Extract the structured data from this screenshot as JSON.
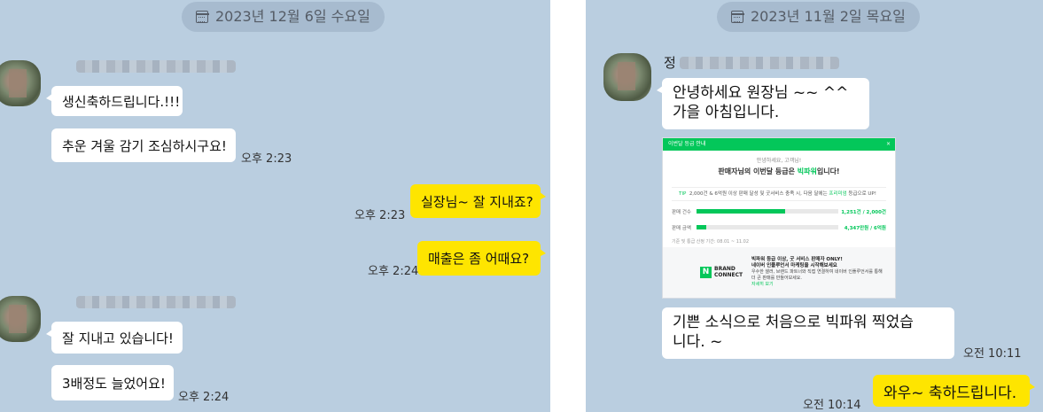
{
  "left_chat": {
    "date": "2023년 12월 6일 수요일",
    "messages": [
      {
        "sender": "them",
        "text": "생신축하드립니다.!!!"
      },
      {
        "sender": "them",
        "text": "추운 겨울 감기 조심하시구요!",
        "time": "오후 2:23"
      },
      {
        "sender": "me",
        "text": "실장님~ 잘 지내죠?",
        "time": "오후 2:23"
      },
      {
        "sender": "me",
        "text": "매출은 좀 어때요?",
        "time": "오후 2:24"
      },
      {
        "sender": "them",
        "text": "잘 지내고 있습니다!"
      },
      {
        "sender": "them",
        "text": "3배정도 늘었어요!",
        "time": "오후 2:24"
      }
    ]
  },
  "right_chat": {
    "date": "2023년 11월 2일 목요일",
    "sender_name": "정",
    "messages": [
      {
        "sender": "them",
        "text": "안녕하세요 원장님 ~~ ^^\n가을 아침입니다."
      },
      {
        "sender": "them",
        "text": "기쁜 소식으로  처음으로 빅파워 찍었습\n니다. ~",
        "time": "오전 10:11"
      },
      {
        "sender": "me",
        "text": "와우~ 축하드립니다.",
        "time": "오전 10:14"
      }
    ],
    "card": {
      "header": "이번달 등급 안내",
      "close": "×",
      "subtitle": "안녕하세요, 고객님!",
      "title_prefix": "판매자님의 이번달 등급은 ",
      "title_grade": "빅파워",
      "title_suffix": "입니다!",
      "tip_badge": "TIP",
      "tip_text_prefix": "2,000건 & 6억원 이상 판매 달성 및 굿서비스 충족 시, 다음 달에는 ",
      "tip_text_highlight": "프리미엄",
      "tip_text_suffix": " 등급으로 UP!",
      "bars": [
        {
          "label": "판매 건수",
          "value_text": "1,251건 / 2,000건",
          "fraction": 0.625
        },
        {
          "label": "판매 금액",
          "value_text": "4,347만원 / 6억원",
          "fraction": 0.07
        }
      ],
      "period": "기준 및 통급 산정 기간: 08.01 ~ 11.02",
      "brand_name_1": "BRAND",
      "brand_name_2": "CONNECT",
      "brand_logo": "N",
      "brand_headline_1": "빅파워 등급 이상, 굿 서비스 판매자 ONLY!",
      "brand_headline_2": "네이버 인플루언서 마케팅을 시작해보세요",
      "brand_body": "우수한 셀러, 브랜드 파트너와 직접 연결하여 네이버 인플루언서를 통해 더 큰 판매를 만들어보세요.",
      "brand_link": "자세히 보기"
    }
  }
}
